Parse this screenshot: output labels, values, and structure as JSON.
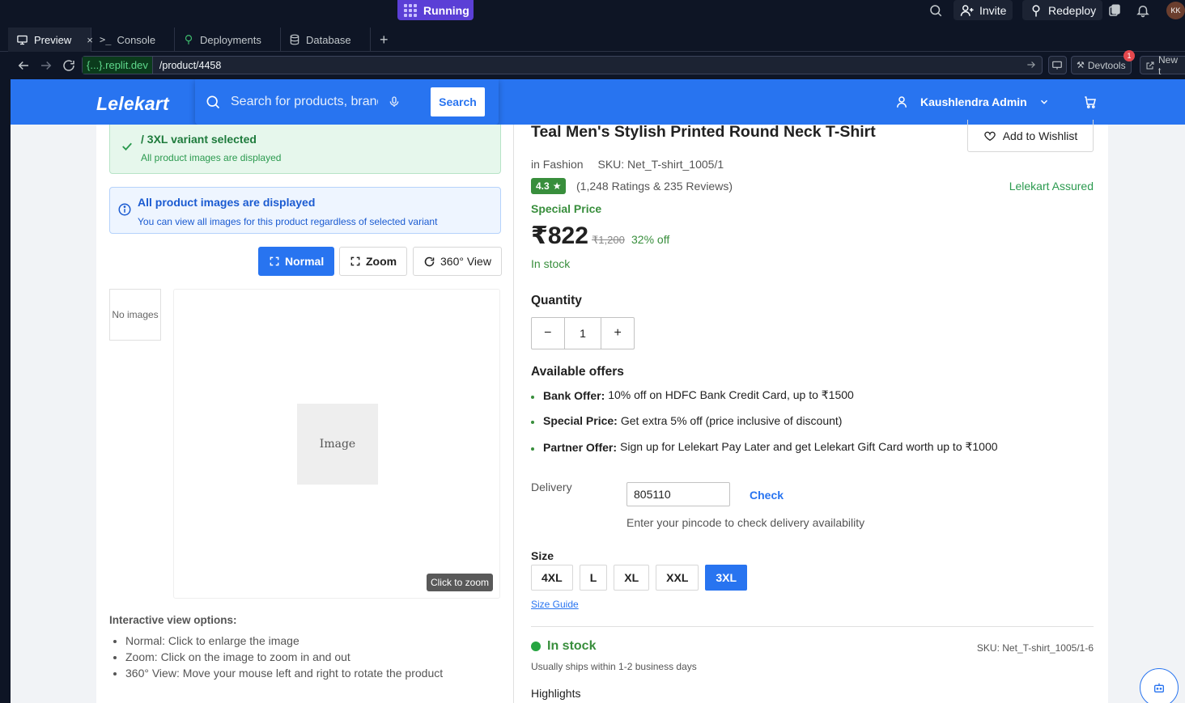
{
  "ide": {
    "run_status": "Running",
    "invite_label": "Invite",
    "redeploy_label": "Redeploy",
    "avatar_initials": "KK",
    "tabs": [
      {
        "label": "Preview",
        "icon": "monitor-icon",
        "active": true
      },
      {
        "label": "Console",
        "icon": "terminal-icon"
      },
      {
        "label": "Deployments",
        "icon": "deploy-icon"
      },
      {
        "label": "Database",
        "icon": "database-icon"
      }
    ],
    "close_glyph": "×",
    "add_tab_glyph": "+",
    "url_host": "{...}.replit.dev",
    "url_path": "/product/4458",
    "devtools_label": "Devtools",
    "devtools_badge": "1",
    "new_tab_label": "New t"
  },
  "header": {
    "logo": "Lelekart",
    "search_placeholder": "Search for products, brands and more",
    "search_button": "Search",
    "user_name": "Kaushlendra Admin"
  },
  "left": {
    "success_title": "/ 3XL variant selected",
    "success_sub": "All product images are displayed",
    "info_title": "All product images are displayed",
    "info_sub": "You can view all images for this product regardless of selected variant",
    "view_buttons": [
      "Normal",
      "Zoom",
      "360° View"
    ],
    "thumb_text": "No images",
    "image_placeholder": "Image",
    "zoom_hint": "Click to zoom",
    "options_title": "Interactive view options:",
    "options": [
      "Normal: Click to enlarge the image",
      "Zoom: Click on the image to zoom in and out",
      "360° View: Move your mouse left and right to rotate the product"
    ]
  },
  "product": {
    "title": "Teal Men's Stylish Printed Round Neck T-Shirt",
    "wishlist": "Add to Wishlist",
    "category": "in Fashion",
    "sku": "SKU: Net_T-shirt_1005/1",
    "rating": "4.3",
    "rating_count": "(1,248 Ratings & 235 Reviews)",
    "assured": "Lelekart Assured",
    "special_price": "Special Price",
    "price": "₹822",
    "mrp": "₹1,200",
    "discount": "32% off",
    "stock": "In stock",
    "quantity_label": "Quantity",
    "quantity": "1",
    "minus": "−",
    "plus": "+",
    "offers_label": "Available offers",
    "offers": [
      {
        "title": "Bank Offer:",
        "text": "10% off on HDFC Bank Credit Card, up to ₹1500"
      },
      {
        "title": "Special Price:",
        "text": "Get extra 5% off (price inclusive of discount)"
      },
      {
        "title": "Partner Offer:",
        "text": "Sign up for Lelekart Pay Later and get Lelekart Gift Card worth up to ₹1000"
      }
    ],
    "delivery_label": "Delivery",
    "pincode": "805110",
    "check_label": "Check",
    "pincode_hint": "Enter your pincode to check delivery availability",
    "size_label": "Size",
    "sizes": [
      "4XL",
      "L",
      "XL",
      "XXL",
      "3XL"
    ],
    "selected_size": "3XL",
    "size_guide": "Size Guide",
    "stock_status": "In stock",
    "variant_sku": "SKU: Net_T-shirt_1005/1-6",
    "ships": "Usually ships within 1-2 business days",
    "highlights": "Highlights"
  },
  "colors": {
    "brand": "#2874f0",
    "success": "#388e3c",
    "ide_bg": "#0e1525",
    "running": "#5b3fd6"
  }
}
